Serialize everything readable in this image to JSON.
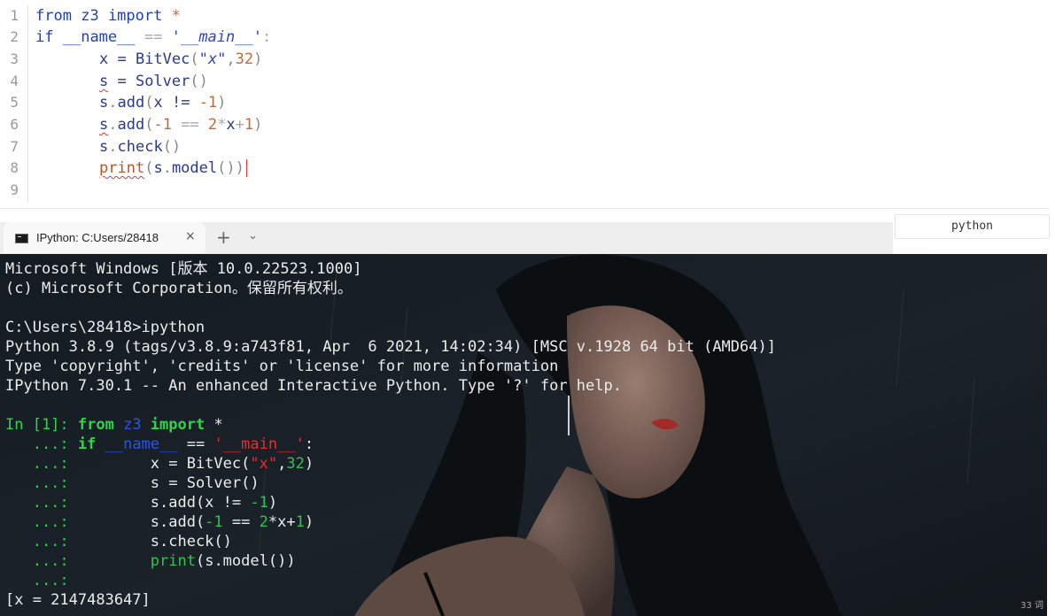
{
  "editor": {
    "line_numbers": [
      "1",
      "2",
      "3",
      "4",
      "5",
      "6",
      "7",
      "8",
      "9"
    ],
    "l1": {
      "from": "from",
      "mod": "z3",
      "import": "import",
      "star": "*"
    },
    "l2": {
      "if": "if",
      "name": "__name__",
      "eq": "==",
      "str": "'__main__'",
      "colon": ":"
    },
    "l3": {
      "x": "x",
      "eq": " = ",
      "fn": "BitVec",
      "open": "(",
      "str": "\"x\"",
      "comma": ",",
      "num": "32",
      "close": ")"
    },
    "l4": {
      "s": "s",
      "eq": " = ",
      "fn": "Solver",
      "parens": "()"
    },
    "l5": {
      "s": "s",
      "dot": ".",
      "fn": "add",
      "open": "(",
      "x": "x",
      "ne": " != ",
      "num": "-1",
      "close": ")"
    },
    "l6": {
      "s": "s",
      "dot": ".",
      "fn": "add",
      "open": "(",
      "num1": "-1",
      "eq": " == ",
      "num2": "2",
      "star": "*",
      "x": "x",
      "plus": "+",
      "num3": "1",
      "close": ")"
    },
    "l7": {
      "s": "s",
      "dot": ".",
      "fn": "check",
      "parens": "()"
    },
    "l8": {
      "print": "print",
      "open": "(",
      "s": "s",
      "dot": ".",
      "fn": "model",
      "rest": "())"
    }
  },
  "language_badge": "python",
  "terminal_tab": {
    "title": "IPython: C:Users/28418",
    "close": "×",
    "new_tab": "+",
    "dropdown": "⌄"
  },
  "terminal": {
    "lines": [
      "Microsoft Windows [版本 10.0.22523.1000]",
      "(c) Microsoft Corporation。保留所有权利。",
      "",
      "C:\\Users\\28418>ipython",
      "Python 3.8.9 (tags/v3.8.9:a743f81, Apr  6 2021, 14:02:34) [MSC v.1928 64 bit (AMD64)]",
      "Type 'copyright', 'credits' or 'license' for more information",
      "IPython 7.30.1 -- An enhanced Interactive Python. Type '?' for help.",
      ""
    ],
    "prompt_in": "In [1]: ",
    "prompt_cont": "   ...: ",
    "input": {
      "l1": {
        "from": "from",
        "mod": " z3 ",
        "import": "import",
        "star": " *"
      },
      "l2": {
        "if": "if ",
        "name": "__name__",
        "eq": " == ",
        "str": "'__main__'",
        "colon": ":"
      },
      "l3": {
        "pre": "        x = BitVec(",
        "str": "\"x\"",
        "comma": ",",
        "num": "32",
        "close": ")"
      },
      "l4": {
        "text": "        s = Solver()"
      },
      "l5": {
        "pre": "        s.add(x != ",
        "num": "-1",
        "close": ")"
      },
      "l6": {
        "pre": "        s.add(",
        "num1": "-1",
        "eq": " == ",
        "num2": "2",
        "mid": "*x+",
        "num3": "1",
        "close": ")"
      },
      "l7": {
        "text": "        s.check()"
      },
      "l8": {
        "pre": "        ",
        "print": "print",
        "rest": "(s.model())"
      }
    },
    "output": "[x = 2147483647]"
  },
  "corner_text": "33 词"
}
